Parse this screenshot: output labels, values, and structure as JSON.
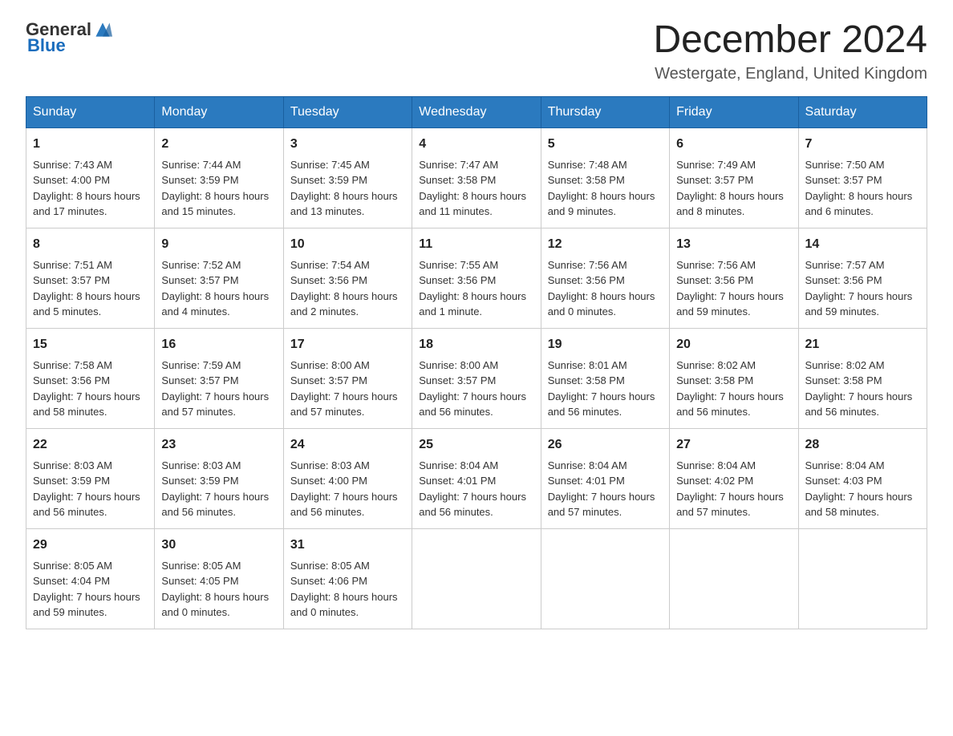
{
  "header": {
    "logo_general": "General",
    "logo_blue": "Blue",
    "month_title": "December 2024",
    "location": "Westergate, England, United Kingdom"
  },
  "days_of_week": [
    "Sunday",
    "Monday",
    "Tuesday",
    "Wednesday",
    "Thursday",
    "Friday",
    "Saturday"
  ],
  "weeks": [
    [
      {
        "day": "1",
        "sunrise": "7:43 AM",
        "sunset": "4:00 PM",
        "daylight": "8 hours and 17 minutes."
      },
      {
        "day": "2",
        "sunrise": "7:44 AM",
        "sunset": "3:59 PM",
        "daylight": "8 hours and 15 minutes."
      },
      {
        "day": "3",
        "sunrise": "7:45 AM",
        "sunset": "3:59 PM",
        "daylight": "8 hours and 13 minutes."
      },
      {
        "day": "4",
        "sunrise": "7:47 AM",
        "sunset": "3:58 PM",
        "daylight": "8 hours and 11 minutes."
      },
      {
        "day": "5",
        "sunrise": "7:48 AM",
        "sunset": "3:58 PM",
        "daylight": "8 hours and 9 minutes."
      },
      {
        "day": "6",
        "sunrise": "7:49 AM",
        "sunset": "3:57 PM",
        "daylight": "8 hours and 8 minutes."
      },
      {
        "day": "7",
        "sunrise": "7:50 AM",
        "sunset": "3:57 PM",
        "daylight": "8 hours and 6 minutes."
      }
    ],
    [
      {
        "day": "8",
        "sunrise": "7:51 AM",
        "sunset": "3:57 PM",
        "daylight": "8 hours and 5 minutes."
      },
      {
        "day": "9",
        "sunrise": "7:52 AM",
        "sunset": "3:57 PM",
        "daylight": "8 hours and 4 minutes."
      },
      {
        "day": "10",
        "sunrise": "7:54 AM",
        "sunset": "3:56 PM",
        "daylight": "8 hours and 2 minutes."
      },
      {
        "day": "11",
        "sunrise": "7:55 AM",
        "sunset": "3:56 PM",
        "daylight": "8 hours and 1 minute."
      },
      {
        "day": "12",
        "sunrise": "7:56 AM",
        "sunset": "3:56 PM",
        "daylight": "8 hours and 0 minutes."
      },
      {
        "day": "13",
        "sunrise": "7:56 AM",
        "sunset": "3:56 PM",
        "daylight": "7 hours and 59 minutes."
      },
      {
        "day": "14",
        "sunrise": "7:57 AM",
        "sunset": "3:56 PM",
        "daylight": "7 hours and 59 minutes."
      }
    ],
    [
      {
        "day": "15",
        "sunrise": "7:58 AM",
        "sunset": "3:56 PM",
        "daylight": "7 hours and 58 minutes."
      },
      {
        "day": "16",
        "sunrise": "7:59 AM",
        "sunset": "3:57 PM",
        "daylight": "7 hours and 57 minutes."
      },
      {
        "day": "17",
        "sunrise": "8:00 AM",
        "sunset": "3:57 PM",
        "daylight": "7 hours and 57 minutes."
      },
      {
        "day": "18",
        "sunrise": "8:00 AM",
        "sunset": "3:57 PM",
        "daylight": "7 hours and 56 minutes."
      },
      {
        "day": "19",
        "sunrise": "8:01 AM",
        "sunset": "3:58 PM",
        "daylight": "7 hours and 56 minutes."
      },
      {
        "day": "20",
        "sunrise": "8:02 AM",
        "sunset": "3:58 PM",
        "daylight": "7 hours and 56 minutes."
      },
      {
        "day": "21",
        "sunrise": "8:02 AM",
        "sunset": "3:58 PM",
        "daylight": "7 hours and 56 minutes."
      }
    ],
    [
      {
        "day": "22",
        "sunrise": "8:03 AM",
        "sunset": "3:59 PM",
        "daylight": "7 hours and 56 minutes."
      },
      {
        "day": "23",
        "sunrise": "8:03 AM",
        "sunset": "3:59 PM",
        "daylight": "7 hours and 56 minutes."
      },
      {
        "day": "24",
        "sunrise": "8:03 AM",
        "sunset": "4:00 PM",
        "daylight": "7 hours and 56 minutes."
      },
      {
        "day": "25",
        "sunrise": "8:04 AM",
        "sunset": "4:01 PM",
        "daylight": "7 hours and 56 minutes."
      },
      {
        "day": "26",
        "sunrise": "8:04 AM",
        "sunset": "4:01 PM",
        "daylight": "7 hours and 57 minutes."
      },
      {
        "day": "27",
        "sunrise": "8:04 AM",
        "sunset": "4:02 PM",
        "daylight": "7 hours and 57 minutes."
      },
      {
        "day": "28",
        "sunrise": "8:04 AM",
        "sunset": "4:03 PM",
        "daylight": "7 hours and 58 minutes."
      }
    ],
    [
      {
        "day": "29",
        "sunrise": "8:05 AM",
        "sunset": "4:04 PM",
        "daylight": "7 hours and 59 minutes."
      },
      {
        "day": "30",
        "sunrise": "8:05 AM",
        "sunset": "4:05 PM",
        "daylight": "8 hours and 0 minutes."
      },
      {
        "day": "31",
        "sunrise": "8:05 AM",
        "sunset": "4:06 PM",
        "daylight": "8 hours and 0 minutes."
      },
      null,
      null,
      null,
      null
    ]
  ],
  "labels": {
    "sunrise": "Sunrise:",
    "sunset": "Sunset:",
    "daylight": "Daylight:"
  }
}
